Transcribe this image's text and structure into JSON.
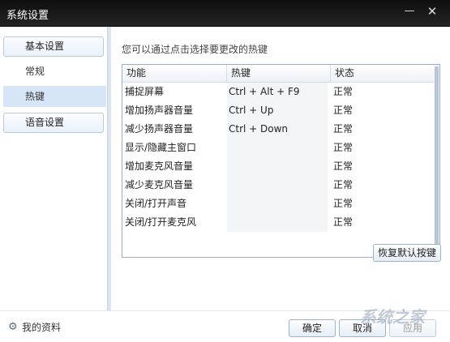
{
  "window": {
    "title": "系统设置",
    "minimize_glyph": "—",
    "close_glyph": "✕"
  },
  "sidebar": {
    "basic_group": "基本设置",
    "items": [
      {
        "label": "常规",
        "active": false
      },
      {
        "label": "热键",
        "active": true
      }
    ],
    "voice_group": "语音设置"
  },
  "main": {
    "hint": "您可以通过点击选择要更改的热键",
    "table": {
      "headers": [
        "功能",
        "热键",
        "状态"
      ],
      "rows": [
        {
          "function": "捕捉屏幕",
          "hotkey": "Ctrl + Alt + F9",
          "status": "正常"
        },
        {
          "function": "增加扬声器音量",
          "hotkey": "Ctrl + Up",
          "status": "正常"
        },
        {
          "function": "减少扬声器音量",
          "hotkey": "Ctrl + Down",
          "status": "正常"
        },
        {
          "function": "显示/隐藏主窗口",
          "hotkey": "",
          "status": "正常"
        },
        {
          "function": "增加麦克风音量",
          "hotkey": "",
          "status": "正常"
        },
        {
          "function": "减少麦克风音量",
          "hotkey": "",
          "status": "正常"
        },
        {
          "function": "关闭/打开声音",
          "hotkey": "",
          "status": "正常"
        },
        {
          "function": "关闭/打开麦克风",
          "hotkey": "",
          "status": "正常"
        }
      ]
    },
    "restore_label": "恢复默认按键"
  },
  "footer": {
    "profile_label": "我的资料",
    "profile_icon": "gear-icon",
    "ok_label": "确定",
    "cancel_label": "取消",
    "apply_label": "应用"
  },
  "watermark": {
    "text": "系统之家"
  },
  "colors": {
    "titlebar": "#1a1a1a",
    "selected_item": "#d6e6f6",
    "accent_border": "#9fb3c8"
  }
}
